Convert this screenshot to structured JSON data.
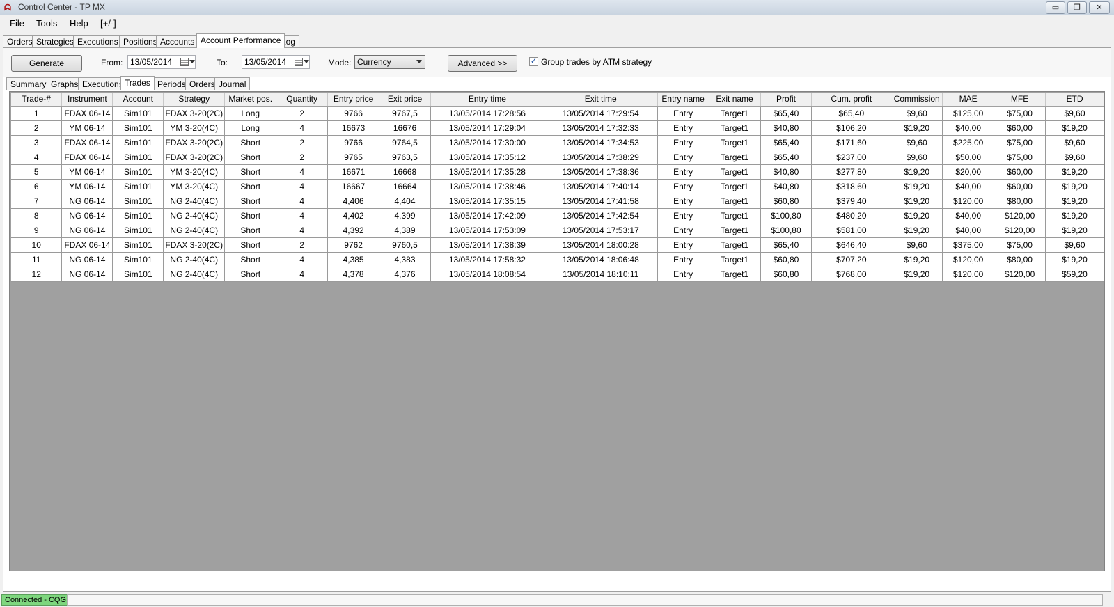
{
  "window": {
    "title": "Control Center - TP MX",
    "minimize": "▭",
    "restore": "❐",
    "close": "✕",
    "app_icon": "a-logo-icon"
  },
  "menu": {
    "file": "File",
    "tools": "Tools",
    "help": "Help",
    "toggle": "[+/-]"
  },
  "top_tabs": [
    "Orders",
    "Strategies",
    "Executions",
    "Positions",
    "Accounts",
    "Account Performance",
    "Log"
  ],
  "top_tab_active": "Account Performance",
  "toolbar": {
    "generate_label": "Generate",
    "from_label": "From:",
    "from_value": "13/05/2014",
    "to_label": "To:",
    "to_value": "13/05/2014",
    "mode_label": "Mode:",
    "mode_value": "Currency",
    "advanced_label": "Advanced >>",
    "group_trades_checked": "✓",
    "group_trades_label": "Group trades by ATM strategy"
  },
  "sub_tabs": [
    "Summary",
    "Graphs",
    "Executions",
    "Trades",
    "Periods",
    "Orders",
    "Journal"
  ],
  "sub_tab_active": "Trades",
  "table": {
    "headers": [
      "Trade-#",
      "Instrument",
      "Account",
      "Strategy",
      "Market pos.",
      "Quantity",
      "Entry price",
      "Exit price",
      "Entry time",
      "Exit time",
      "Entry name",
      "Exit name",
      "Profit",
      "Cum. profit",
      "Commission",
      "MAE",
      "MFE",
      "ETD"
    ],
    "rows": [
      [
        "1",
        "FDAX 06-14",
        "Sim101",
        "FDAX 3-20(2C)",
        "Long",
        "2",
        "9766",
        "9767,5",
        "13/05/2014 17:28:56",
        "13/05/2014 17:29:54",
        "Entry",
        "Target1",
        "$65,40",
        "$65,40",
        "$9,60",
        "$125,00",
        "$75,00",
        "$9,60"
      ],
      [
        "2",
        "YM 06-14",
        "Sim101",
        "YM 3-20(4C)",
        "Long",
        "4",
        "16673",
        "16676",
        "13/05/2014 17:29:04",
        "13/05/2014 17:32:33",
        "Entry",
        "Target1",
        "$40,80",
        "$106,20",
        "$19,20",
        "$40,00",
        "$60,00",
        "$19,20"
      ],
      [
        "3",
        "FDAX 06-14",
        "Sim101",
        "FDAX 3-20(2C)",
        "Short",
        "2",
        "9766",
        "9764,5",
        "13/05/2014 17:30:00",
        "13/05/2014 17:34:53",
        "Entry",
        "Target1",
        "$65,40",
        "$171,60",
        "$9,60",
        "$225,00",
        "$75,00",
        "$9,60"
      ],
      [
        "4",
        "FDAX 06-14",
        "Sim101",
        "FDAX 3-20(2C)",
        "Short",
        "2",
        "9765",
        "9763,5",
        "13/05/2014 17:35:12",
        "13/05/2014 17:38:29",
        "Entry",
        "Target1",
        "$65,40",
        "$237,00",
        "$9,60",
        "$50,00",
        "$75,00",
        "$9,60"
      ],
      [
        "5",
        "YM 06-14",
        "Sim101",
        "YM 3-20(4C)",
        "Short",
        "4",
        "16671",
        "16668",
        "13/05/2014 17:35:28",
        "13/05/2014 17:38:36",
        "Entry",
        "Target1",
        "$40,80",
        "$277,80",
        "$19,20",
        "$20,00",
        "$60,00",
        "$19,20"
      ],
      [
        "6",
        "YM 06-14",
        "Sim101",
        "YM 3-20(4C)",
        "Short",
        "4",
        "16667",
        "16664",
        "13/05/2014 17:38:46",
        "13/05/2014 17:40:14",
        "Entry",
        "Target1",
        "$40,80",
        "$318,60",
        "$19,20",
        "$40,00",
        "$60,00",
        "$19,20"
      ],
      [
        "7",
        "NG 06-14",
        "Sim101",
        "NG 2-40(4C)",
        "Short",
        "4",
        "4,406",
        "4,404",
        "13/05/2014 17:35:15",
        "13/05/2014 17:41:58",
        "Entry",
        "Target1",
        "$60,80",
        "$379,40",
        "$19,20",
        "$120,00",
        "$80,00",
        "$19,20"
      ],
      [
        "8",
        "NG 06-14",
        "Sim101",
        "NG 2-40(4C)",
        "Short",
        "4",
        "4,402",
        "4,399",
        "13/05/2014 17:42:09",
        "13/05/2014 17:42:54",
        "Entry",
        "Target1",
        "$100,80",
        "$480,20",
        "$19,20",
        "$40,00",
        "$120,00",
        "$19,20"
      ],
      [
        "9",
        "NG 06-14",
        "Sim101",
        "NG 2-40(4C)",
        "Short",
        "4",
        "4,392",
        "4,389",
        "13/05/2014 17:53:09",
        "13/05/2014 17:53:17",
        "Entry",
        "Target1",
        "$100,80",
        "$581,00",
        "$19,20",
        "$40,00",
        "$120,00",
        "$19,20"
      ],
      [
        "10",
        "FDAX 06-14",
        "Sim101",
        "FDAX 3-20(2C)",
        "Short",
        "2",
        "9762",
        "9760,5",
        "13/05/2014 17:38:39",
        "13/05/2014 18:00:28",
        "Entry",
        "Target1",
        "$65,40",
        "$646,40",
        "$9,60",
        "$375,00",
        "$75,00",
        "$9,60"
      ],
      [
        "11",
        "NG 06-14",
        "Sim101",
        "NG 2-40(4C)",
        "Short",
        "4",
        "4,385",
        "4,383",
        "13/05/2014 17:58:32",
        "13/05/2014 18:06:48",
        "Entry",
        "Target1",
        "$60,80",
        "$707,20",
        "$19,20",
        "$120,00",
        "$80,00",
        "$19,20"
      ],
      [
        "12",
        "NG 06-14",
        "Sim101",
        "NG 2-40(4C)",
        "Short",
        "4",
        "4,378",
        "4,376",
        "13/05/2014 18:08:54",
        "13/05/2014 18:10:11",
        "Entry",
        "Target1",
        "$60,80",
        "$768,00",
        "$19,20",
        "$120,00",
        "$120,00",
        "$59,20"
      ]
    ]
  },
  "status": {
    "connection": "Connected - CQG",
    "connection_color": "#7ed67e"
  }
}
